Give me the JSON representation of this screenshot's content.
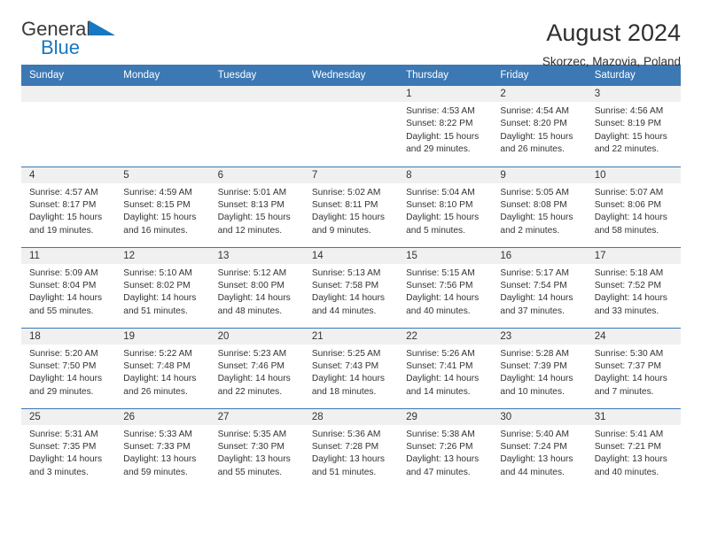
{
  "brand": {
    "name_part1": "General",
    "name_part2": "Blue",
    "triangle_icon": "triangle-icon",
    "color_dark": "#3a3a3a",
    "color_blue": "#1777c0"
  },
  "header": {
    "title": "August 2024",
    "subtitle": "Skorzec, Mazovia, Poland"
  },
  "theme": {
    "header_bg": "#3c78b4",
    "header_text": "#ffffff",
    "daynum_bg": "#f0f0f0",
    "body_text": "#333333",
    "separator": "#3c78b4"
  },
  "weekdays": [
    "Sunday",
    "Monday",
    "Tuesday",
    "Wednesday",
    "Thursday",
    "Friday",
    "Saturday"
  ],
  "weeks": [
    [
      {
        "day": "",
        "sunrise": "",
        "sunset": "",
        "daylight_line1": "",
        "daylight_line2": ""
      },
      {
        "day": "",
        "sunrise": "",
        "sunset": "",
        "daylight_line1": "",
        "daylight_line2": ""
      },
      {
        "day": "",
        "sunrise": "",
        "sunset": "",
        "daylight_line1": "",
        "daylight_line2": ""
      },
      {
        "day": "",
        "sunrise": "",
        "sunset": "",
        "daylight_line1": "",
        "daylight_line2": ""
      },
      {
        "day": "1",
        "sunrise": "Sunrise: 4:53 AM",
        "sunset": "Sunset: 8:22 PM",
        "daylight_line1": "Daylight: 15 hours",
        "daylight_line2": "and 29 minutes."
      },
      {
        "day": "2",
        "sunrise": "Sunrise: 4:54 AM",
        "sunset": "Sunset: 8:20 PM",
        "daylight_line1": "Daylight: 15 hours",
        "daylight_line2": "and 26 minutes."
      },
      {
        "day": "3",
        "sunrise": "Sunrise: 4:56 AM",
        "sunset": "Sunset: 8:19 PM",
        "daylight_line1": "Daylight: 15 hours",
        "daylight_line2": "and 22 minutes."
      }
    ],
    [
      {
        "day": "4",
        "sunrise": "Sunrise: 4:57 AM",
        "sunset": "Sunset: 8:17 PM",
        "daylight_line1": "Daylight: 15 hours",
        "daylight_line2": "and 19 minutes."
      },
      {
        "day": "5",
        "sunrise": "Sunrise: 4:59 AM",
        "sunset": "Sunset: 8:15 PM",
        "daylight_line1": "Daylight: 15 hours",
        "daylight_line2": "and 16 minutes."
      },
      {
        "day": "6",
        "sunrise": "Sunrise: 5:01 AM",
        "sunset": "Sunset: 8:13 PM",
        "daylight_line1": "Daylight: 15 hours",
        "daylight_line2": "and 12 minutes."
      },
      {
        "day": "7",
        "sunrise": "Sunrise: 5:02 AM",
        "sunset": "Sunset: 8:11 PM",
        "daylight_line1": "Daylight: 15 hours",
        "daylight_line2": "and 9 minutes."
      },
      {
        "day": "8",
        "sunrise": "Sunrise: 5:04 AM",
        "sunset": "Sunset: 8:10 PM",
        "daylight_line1": "Daylight: 15 hours",
        "daylight_line2": "and 5 minutes."
      },
      {
        "day": "9",
        "sunrise": "Sunrise: 5:05 AM",
        "sunset": "Sunset: 8:08 PM",
        "daylight_line1": "Daylight: 15 hours",
        "daylight_line2": "and 2 minutes."
      },
      {
        "day": "10",
        "sunrise": "Sunrise: 5:07 AM",
        "sunset": "Sunset: 8:06 PM",
        "daylight_line1": "Daylight: 14 hours",
        "daylight_line2": "and 58 minutes."
      }
    ],
    [
      {
        "day": "11",
        "sunrise": "Sunrise: 5:09 AM",
        "sunset": "Sunset: 8:04 PM",
        "daylight_line1": "Daylight: 14 hours",
        "daylight_line2": "and 55 minutes."
      },
      {
        "day": "12",
        "sunrise": "Sunrise: 5:10 AM",
        "sunset": "Sunset: 8:02 PM",
        "daylight_line1": "Daylight: 14 hours",
        "daylight_line2": "and 51 minutes."
      },
      {
        "day": "13",
        "sunrise": "Sunrise: 5:12 AM",
        "sunset": "Sunset: 8:00 PM",
        "daylight_line1": "Daylight: 14 hours",
        "daylight_line2": "and 48 minutes."
      },
      {
        "day": "14",
        "sunrise": "Sunrise: 5:13 AM",
        "sunset": "Sunset: 7:58 PM",
        "daylight_line1": "Daylight: 14 hours",
        "daylight_line2": "and 44 minutes."
      },
      {
        "day": "15",
        "sunrise": "Sunrise: 5:15 AM",
        "sunset": "Sunset: 7:56 PM",
        "daylight_line1": "Daylight: 14 hours",
        "daylight_line2": "and 40 minutes."
      },
      {
        "day": "16",
        "sunrise": "Sunrise: 5:17 AM",
        "sunset": "Sunset: 7:54 PM",
        "daylight_line1": "Daylight: 14 hours",
        "daylight_line2": "and 37 minutes."
      },
      {
        "day": "17",
        "sunrise": "Sunrise: 5:18 AM",
        "sunset": "Sunset: 7:52 PM",
        "daylight_line1": "Daylight: 14 hours",
        "daylight_line2": "and 33 minutes."
      }
    ],
    [
      {
        "day": "18",
        "sunrise": "Sunrise: 5:20 AM",
        "sunset": "Sunset: 7:50 PM",
        "daylight_line1": "Daylight: 14 hours",
        "daylight_line2": "and 29 minutes."
      },
      {
        "day": "19",
        "sunrise": "Sunrise: 5:22 AM",
        "sunset": "Sunset: 7:48 PM",
        "daylight_line1": "Daylight: 14 hours",
        "daylight_line2": "and 26 minutes."
      },
      {
        "day": "20",
        "sunrise": "Sunrise: 5:23 AM",
        "sunset": "Sunset: 7:46 PM",
        "daylight_line1": "Daylight: 14 hours",
        "daylight_line2": "and 22 minutes."
      },
      {
        "day": "21",
        "sunrise": "Sunrise: 5:25 AM",
        "sunset": "Sunset: 7:43 PM",
        "daylight_line1": "Daylight: 14 hours",
        "daylight_line2": "and 18 minutes."
      },
      {
        "day": "22",
        "sunrise": "Sunrise: 5:26 AM",
        "sunset": "Sunset: 7:41 PM",
        "daylight_line1": "Daylight: 14 hours",
        "daylight_line2": "and 14 minutes."
      },
      {
        "day": "23",
        "sunrise": "Sunrise: 5:28 AM",
        "sunset": "Sunset: 7:39 PM",
        "daylight_line1": "Daylight: 14 hours",
        "daylight_line2": "and 10 minutes."
      },
      {
        "day": "24",
        "sunrise": "Sunrise: 5:30 AM",
        "sunset": "Sunset: 7:37 PM",
        "daylight_line1": "Daylight: 14 hours",
        "daylight_line2": "and 7 minutes."
      }
    ],
    [
      {
        "day": "25",
        "sunrise": "Sunrise: 5:31 AM",
        "sunset": "Sunset: 7:35 PM",
        "daylight_line1": "Daylight: 14 hours",
        "daylight_line2": "and 3 minutes."
      },
      {
        "day": "26",
        "sunrise": "Sunrise: 5:33 AM",
        "sunset": "Sunset: 7:33 PM",
        "daylight_line1": "Daylight: 13 hours",
        "daylight_line2": "and 59 minutes."
      },
      {
        "day": "27",
        "sunrise": "Sunrise: 5:35 AM",
        "sunset": "Sunset: 7:30 PM",
        "daylight_line1": "Daylight: 13 hours",
        "daylight_line2": "and 55 minutes."
      },
      {
        "day": "28",
        "sunrise": "Sunrise: 5:36 AM",
        "sunset": "Sunset: 7:28 PM",
        "daylight_line1": "Daylight: 13 hours",
        "daylight_line2": "and 51 minutes."
      },
      {
        "day": "29",
        "sunrise": "Sunrise: 5:38 AM",
        "sunset": "Sunset: 7:26 PM",
        "daylight_line1": "Daylight: 13 hours",
        "daylight_line2": "and 47 minutes."
      },
      {
        "day": "30",
        "sunrise": "Sunrise: 5:40 AM",
        "sunset": "Sunset: 7:24 PM",
        "daylight_line1": "Daylight: 13 hours",
        "daylight_line2": "and 44 minutes."
      },
      {
        "day": "31",
        "sunrise": "Sunrise: 5:41 AM",
        "sunset": "Sunset: 7:21 PM",
        "daylight_line1": "Daylight: 13 hours",
        "daylight_line2": "and 40 minutes."
      }
    ]
  ]
}
